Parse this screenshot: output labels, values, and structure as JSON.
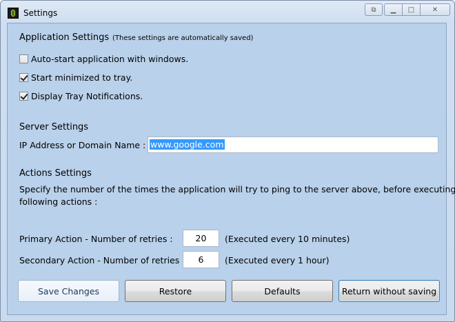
{
  "window": {
    "title": "Settings"
  },
  "application": {
    "heading": "Application Settings",
    "note": "(These settings are automatically saved)",
    "options": [
      {
        "label": "Auto-start application with windows.",
        "checked": false
      },
      {
        "label": "Start minimized to tray.",
        "checked": true
      },
      {
        "label": "Display Tray Notifications.",
        "checked": true
      }
    ]
  },
  "server": {
    "heading": "Server Settings",
    "ip_label": "IP Address or Domain Name :",
    "ip_value": "www.google.com"
  },
  "actions": {
    "heading": "Actions Settings",
    "description_line1": "Specify the number of the times the application will try to ping to the server above, before executing the",
    "description_line2": "following actions :",
    "primary": {
      "label": "Primary Action - Number of retries :",
      "value": "20",
      "note": "(Executed every 10 minutes)"
    },
    "secondary": {
      "label": "Secondary Action - Number of retries :",
      "value": "6",
      "note": "(Executed every 1 hour)"
    }
  },
  "buttons": {
    "save": "Save Changes",
    "restore": "Restore",
    "defaults": "Defaults",
    "return": "Return without saving"
  },
  "colors": {
    "client_bg": "#b9d1ea",
    "selection": "#3399ff"
  }
}
